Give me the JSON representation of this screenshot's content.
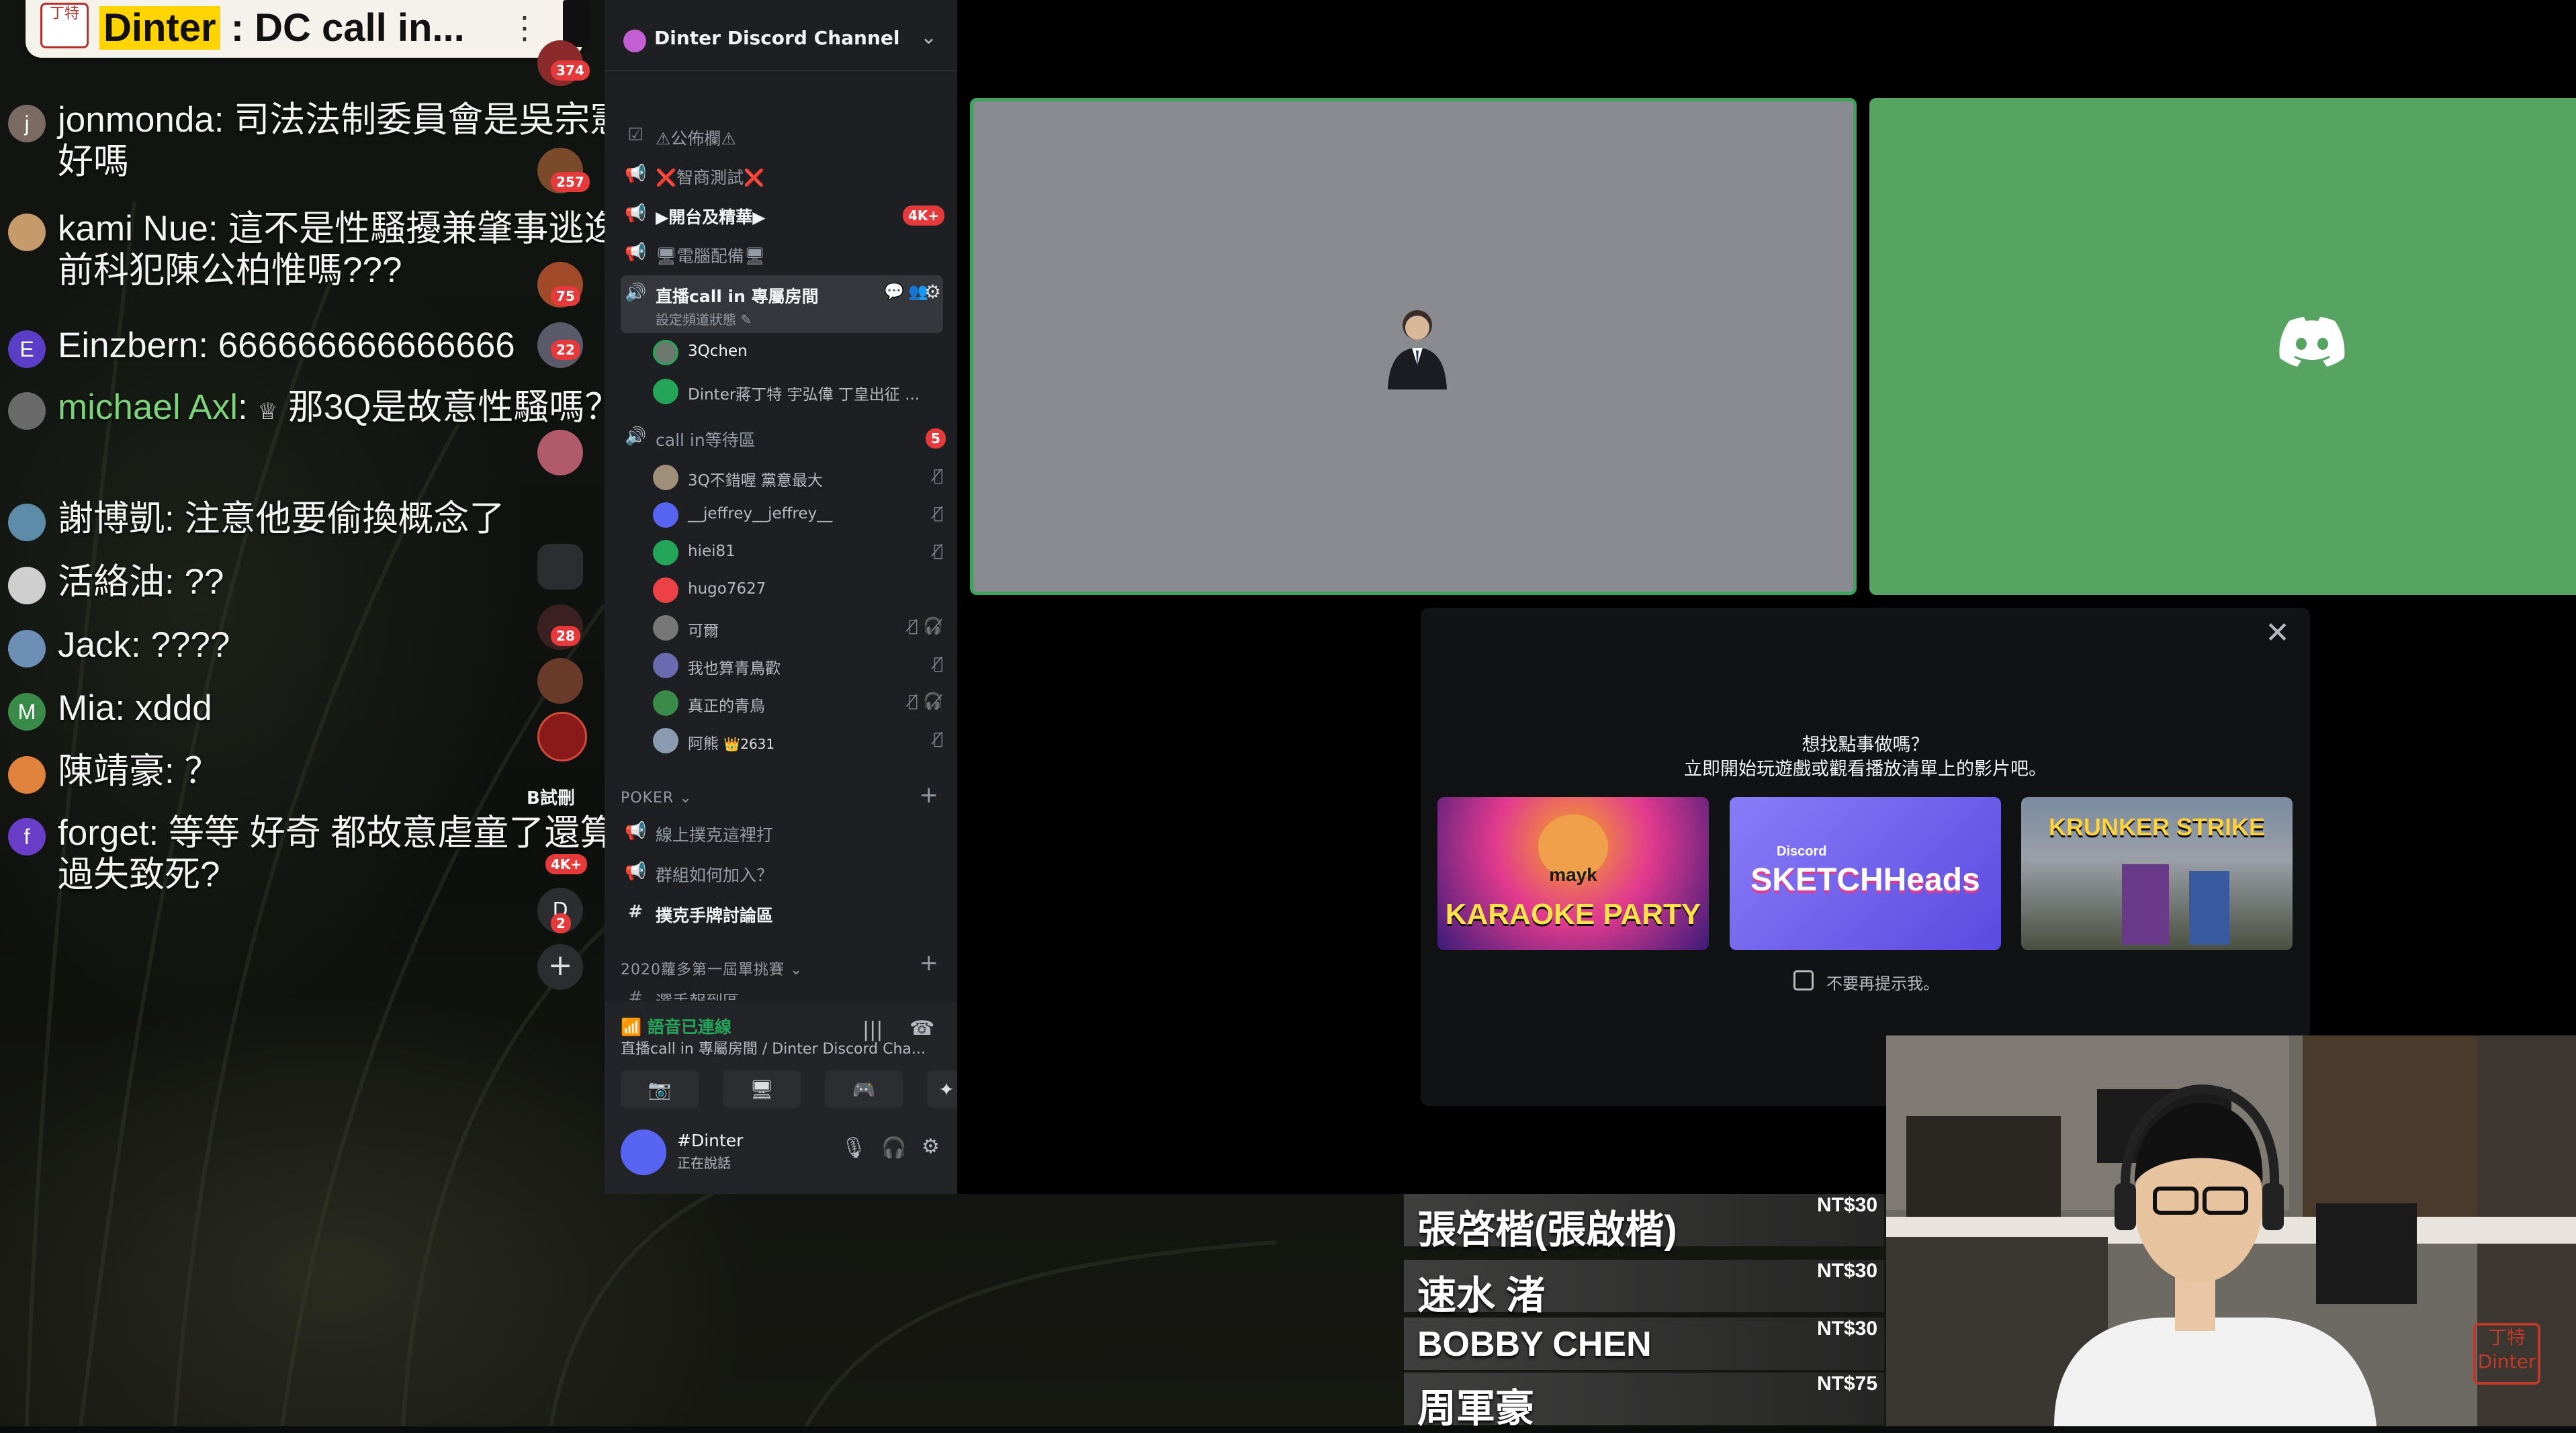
{
  "window_title": "Dinter Discord Channel",
  "chat": {
    "header": {
      "logo": "丁特",
      "title_highlight": "Dinter",
      "title_rest": " : DC call in..."
    },
    "messages": [
      {
        "name": "jonmonda",
        "text": "司法法制委員會是吳宗憲 好嗎",
        "avatar_letter": "j",
        "avatar_color": "#7a6a62"
      },
      {
        "name": "kami Nue",
        "text": "這不是性騷擾兼肇事逃逸前科犯陳公柏惟嗎???",
        "avatar_letter": "",
        "avatar_color": "#c79a6a"
      },
      {
        "name": "Einzbern",
        "text": "666666666666666",
        "avatar_letter": "E",
        "avatar_color": "#5b3ec8"
      },
      {
        "name": "michael Axl",
        "text": "那3Q是故意性騷嗎？",
        "avatar_letter": "",
        "avatar_color": "#6a6a6a"
      },
      {
        "name": "謝博凱",
        "text": "注意他要偷換概念了",
        "avatar_letter": "",
        "avatar_color": "#5d8ca8"
      },
      {
        "name": "活絡油",
        "text": "??",
        "avatar_letter": "",
        "avatar_color": "#cfcfcf"
      },
      {
        "name": "Jack",
        "text": "????",
        "avatar_letter": "",
        "avatar_color": "#6d8fb6"
      },
      {
        "name": "Mia",
        "text": "xddd",
        "avatar_letter": "M",
        "avatar_color": "#3a8a4a"
      },
      {
        "name": "陳靖豪",
        "text": "？",
        "avatar_letter": "",
        "avatar_color": "#e0823b"
      },
      {
        "name": "forget",
        "text": "等等 好奇 都故意虐童了還算過失致死?",
        "avatar_letter": "f",
        "avatar_color": "#6a3ec8"
      }
    ]
  },
  "server_badges": [
    "374",
    "257",
    "75",
    "22",
    "28",
    "4K+",
    "2"
  ],
  "server_labels": {
    "b": "B試刪",
    "d": "D"
  },
  "discord": {
    "server_name": "Dinter Discord Channel",
    "channels": [
      {
        "label": "⚠公佈欄⚠",
        "icon": "checklist-icon"
      },
      {
        "label": "❌智商測試❌",
        "icon": "megaphone-icon"
      },
      {
        "label": "▶開台及精華▶",
        "icon": "megaphone-icon",
        "badge": "4K+",
        "bold": true
      },
      {
        "label": "🖥電腦配備🖥",
        "icon": "megaphone-icon"
      }
    ],
    "active_channel": {
      "label": "直播call in 專屬房間",
      "sub": "設定頻道狀態 ✎"
    },
    "active_users": [
      {
        "name": "3Qchen",
        "color": "#6c7a6e"
      },
      {
        "name": "Dinter蔣丁特 宇弘偉 丁皇出征 ...",
        "color": "#23a55a"
      }
    ],
    "waiting_channel": {
      "label": "call in等待區",
      "badge": "5"
    },
    "waiting_users": [
      {
        "name": "3Q不錯喔 黨意最大",
        "color": "#a0907a",
        "status": "🎙̸"
      },
      {
        "name": "__jeffrey__jeffrey__",
        "color": "#5865f2",
        "status": "🎙̸"
      },
      {
        "name": "hiei81",
        "color": "#23a55a",
        "status": "🎙̸"
      },
      {
        "name": "hugo7627",
        "color": "#ed4245",
        "status": ""
      },
      {
        "name": "可爾",
        "color": "#777777",
        "status": "🎙̸ 🎧̸"
      },
      {
        "name": "我也算青鳥歡",
        "color": "#6a6ab0",
        "status": "🎙̸"
      },
      {
        "name": "真正的青鳥",
        "color": "#3a8a4a",
        "status": "🎙̸ 🎧̸"
      },
      {
        "name": "阿熊",
        "color": "#8a9ab0",
        "status": "🎙̸",
        "tag": "👑2631"
      }
    ],
    "category_poker": "POKER ⌄",
    "poker_channels": [
      {
        "label": "線上撲克這裡打",
        "icon": "megaphone-icon"
      },
      {
        "label": "群組如何加入？",
        "icon": "megaphone-icon"
      },
      {
        "label": "撲克手牌討論區",
        "icon": "hash-icon",
        "bold": true
      }
    ],
    "category_2020": "2020蘿多第一屆單挑賽 ⌄",
    "channel_partial": "選手報到區",
    "voice": {
      "status": "語音已連線",
      "location": "直播call in 專屬房間 / Dinter Discord Cha...",
      "user_name": "#Dinter",
      "user_status": "正在說話"
    }
  },
  "activity": {
    "line1": "想找點事做嗎？",
    "line2": "立即開始玩遊戲或觀看播放清單上的影片吧。",
    "games": [
      {
        "title": "KARAOKE PARTY",
        "brand": "mayk",
        "color1": "#e23a8e",
        "color2": "#3a1b7a"
      },
      {
        "title": "SKETCHHeads",
        "brand": "Discord",
        "color1": "#7a6cf0",
        "color2": "#4a3ad0"
      },
      {
        "title": "KRUNKER STRIKE",
        "brand": "",
        "color1": "#7a8aa0",
        "color2": "#3e4a3a"
      }
    ],
    "checkbox_label": "不要再提示我。",
    "close": "✕"
  },
  "donations": [
    {
      "name": "張啓楷(張啟楷)",
      "amount": "NT$30"
    },
    {
      "name": "速水 渚",
      "amount": "NT$30"
    },
    {
      "name": "BOBBY CHEN",
      "amount": "NT$30"
    },
    {
      "name": "周軍豪",
      "amount": "NT$75"
    }
  ],
  "cam_stamp": "丁特 Dinter"
}
